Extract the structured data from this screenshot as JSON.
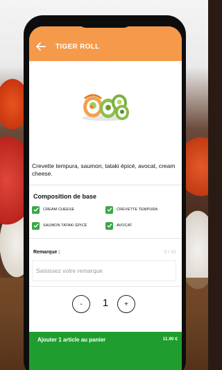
{
  "header": {
    "title": "TIGER ROLL",
    "back_icon": "back-arrow-icon",
    "color": "#f59a4a"
  },
  "product": {
    "image_icon": "sushi-roll-image",
    "description": "Crevette tempura, saumon, tataki épicé, avocat, cream cheese."
  },
  "composition": {
    "title": "Composition de base",
    "options": [
      {
        "label": "CREAM CHEESE",
        "checked": true
      },
      {
        "label": "CREVETTE TEMPURA",
        "checked": true
      },
      {
        "label": "SAUMON TATAKI ÉPICÉ",
        "checked": true
      },
      {
        "label": "AVOCAT",
        "checked": true
      }
    ],
    "check_color": "#3aa64a"
  },
  "remark": {
    "label": "Remarque :",
    "counter": "0 / 42",
    "placeholder": "Saisissez votre remarque",
    "value": ""
  },
  "quantity": {
    "minus_label": "-",
    "value": "1",
    "plus_label": "+"
  },
  "cart": {
    "label": "Ajouter 1 article au panier",
    "price": "11.90 €",
    "color": "#1f9e2f"
  }
}
